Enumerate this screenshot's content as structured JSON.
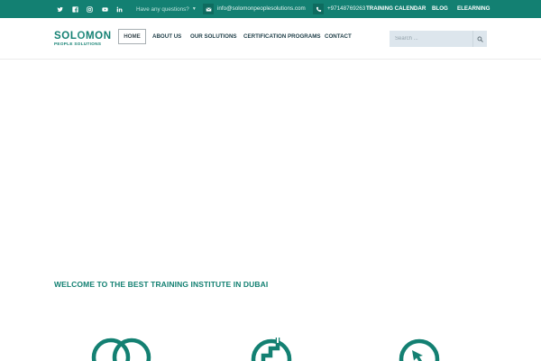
{
  "topbar": {
    "social": [
      "twitter-icon",
      "facebook-icon",
      "instagram-icon",
      "youtube-icon",
      "linkedin-icon"
    ],
    "question_label": "Have any questions?",
    "email": "info@solomonpeoplesolutions.com",
    "phone": "+97148769263",
    "links": [
      "TRAINING CALENDAR",
      "BLOG",
      "ELEARNING"
    ]
  },
  "logo": {
    "main_left": "SOL",
    "main_o": "O",
    "main_right": "MON",
    "sub": "PEOPLE SOLUTIONS"
  },
  "nav": {
    "items": [
      "HOME",
      "ABOUT US",
      "OUR SOLUTIONS",
      "CERTIFICATION PROGRAMS",
      "CONTACT"
    ],
    "active": "HOME"
  },
  "search": {
    "placeholder": "Search ..."
  },
  "main": {
    "welcome_heading": "WELCOME TO THE BEST TRAINING INSTITUTE IN DUBAI",
    "features": [
      "linked-circles-icon",
      "growth-steps-icon",
      "target-arrow-icon"
    ]
  },
  "colors": {
    "brand": "#138072",
    "topbar_bg": "#138072",
    "nav_text": "#21404a",
    "search_bg": "#dde6ed"
  }
}
